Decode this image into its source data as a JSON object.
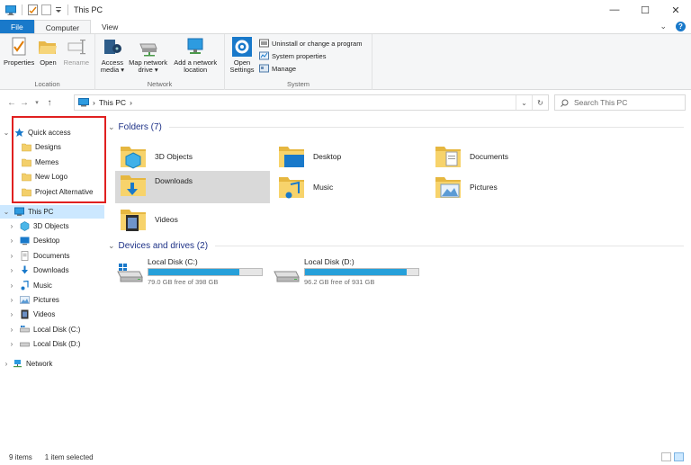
{
  "window": {
    "title": "This PC",
    "minimize": "—",
    "maximize": "☐",
    "close": "✕"
  },
  "tabs": {
    "file": "File",
    "computer": "Computer",
    "view": "View",
    "expand": "⌄",
    "help": "?"
  },
  "ribbon": {
    "location": {
      "label": "Location",
      "properties": "Properties",
      "open": "Open",
      "rename": "Rename"
    },
    "network": {
      "label": "Network",
      "access_media": "Access media ▾",
      "map_network_drive": "Map network drive ▾",
      "add_network_location": "Add a network location"
    },
    "system": {
      "label": "System",
      "open_settings": "Open Settings",
      "uninstall": "Uninstall or change a program",
      "system_properties": "System properties",
      "manage": "Manage"
    }
  },
  "address": {
    "path_root_sep": "›",
    "path": "This PC",
    "path_sep": "›",
    "search_placeholder": "Search This PC"
  },
  "nav": {
    "quick_access": "Quick access",
    "quick_items": [
      "Designs",
      "Memes",
      "New Logo",
      "Project Alternative"
    ],
    "this_pc": "This PC",
    "pc_items": [
      "3D Objects",
      "Desktop",
      "Documents",
      "Downloads",
      "Music",
      "Pictures",
      "Videos",
      "Local Disk (C:)",
      "Local Disk (D:)"
    ],
    "network": "Network"
  },
  "content": {
    "folders_header": "Folders (7)",
    "folders": [
      "3D Objects",
      "Desktop",
      "Documents",
      "Downloads",
      "Music",
      "Pictures",
      "Videos"
    ],
    "drives_header": "Devices and drives (2)",
    "drives": [
      {
        "name": "Local Disk (C:)",
        "free": "79.0 GB free of 398 GB",
        "used_fraction": 0.8
      },
      {
        "name": "Local Disk (D:)",
        "free": "96.2 GB free of 931 GB",
        "used_fraction": 0.9
      }
    ]
  },
  "status": {
    "items": "9 items",
    "selected": "1 item selected"
  },
  "colors": {
    "accent": "#1979ca",
    "highlight": "#e02020",
    "selection": "#cce8ff",
    "drive_bar": "#26a0da"
  }
}
